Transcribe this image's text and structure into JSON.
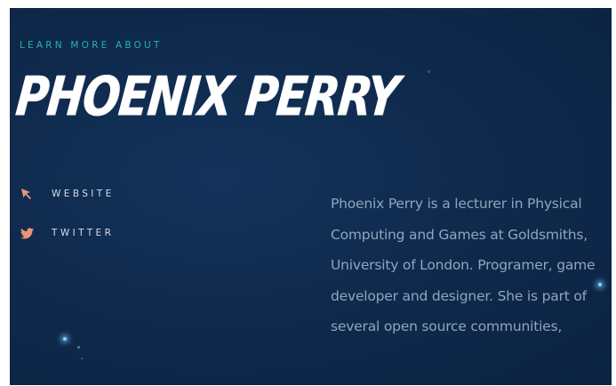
{
  "hero": {
    "eyebrow": "LEARN MORE ABOUT",
    "name": "PHOENIX PERRY"
  },
  "links": [
    {
      "label": "WEBSITE",
      "icon": "cursor-arrow-icon",
      "color": "#e8957a"
    },
    {
      "label": "TWITTER",
      "icon": "twitter-bird-icon",
      "color": "#e8957a"
    }
  ],
  "bio": "Phoenix Perry is a lecturer in Physical Computing and Games at Goldsmiths, University of London. Programer, game developer and designer. She is part of several open source communities,",
  "colors": {
    "background": "#0f2a4d",
    "accent": "#27b3a8",
    "link_icon": "#e8957a"
  }
}
